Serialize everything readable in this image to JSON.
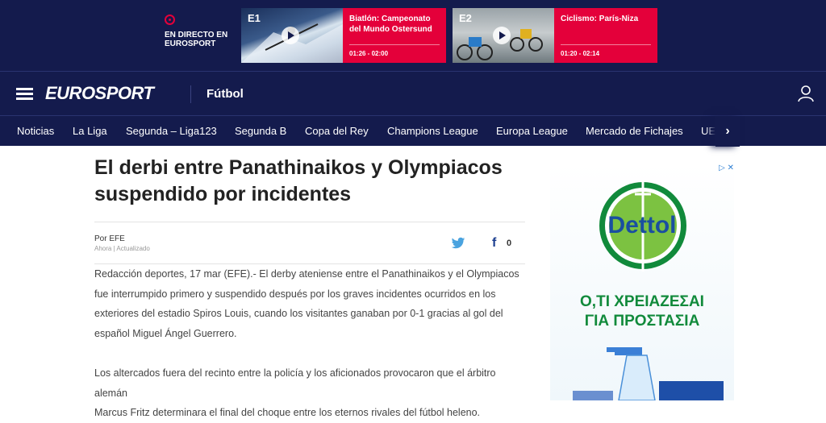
{
  "live_strip": {
    "label_line1": "EN DIRECTO EN",
    "label_line2": "EUROSPORT",
    "cards": [
      {
        "channel": "E1",
        "title": "Biatlón: Campeonato del Mundo Ostersund",
        "time": "01:26 - 02:00"
      },
      {
        "channel": "E2",
        "title": "Ciclismo: París-Niza",
        "time": "01:20 - 02:14"
      }
    ]
  },
  "header": {
    "logo": "EUROSPORT",
    "section": "Fútbol"
  },
  "nav": {
    "items": [
      "Noticias",
      "La Liga",
      "Segunda – Liga123",
      "Segunda B",
      "Copa del Rey",
      "Champions League",
      "Europa League",
      "Mercado de Fichajes",
      "UE"
    ],
    "more": "›"
  },
  "article": {
    "headline_line1": "El derbi entre Panathinaikos y Olympiacos",
    "headline_line2": "suspendido por incidentes",
    "byline": "Por EFE",
    "meta": "Ahora | Actualizado",
    "share_count": "0",
    "para1_lines": [
      "Redacción deportes, 17 mar (EFE).- El derby ateniense entre el Panathinaikos y el Olympiacos",
      "fue interrumpido primero y suspendido después por los graves incidentes ocurridos en los",
      "exteriores del estadio Spiros Louis, cuando los visitantes ganaban por 0-1 gracias al gol del",
      "español Miguel Ángel Guerrero."
    ],
    "para2_lines": [
      "Los altercados fuera del recinto entre la policía y los aficionados provocaron que el árbitro alemán",
      "Marcus Fritz determinara el final del choque entre los eternos rivales del fútbol heleno."
    ]
  },
  "ad": {
    "badge": "▷ ✕",
    "brand": "Dettol",
    "line1": "Ο,ΤΙ ΧΡΕΙΑΖΕΣΑΙ",
    "line2": "ΓΙΑ ΠΡΟΣΤΑΣΙΑ"
  },
  "colors": {
    "navy": "#141b4d",
    "accent_red": "#e4003a",
    "dettol_green": "#118a3b"
  }
}
